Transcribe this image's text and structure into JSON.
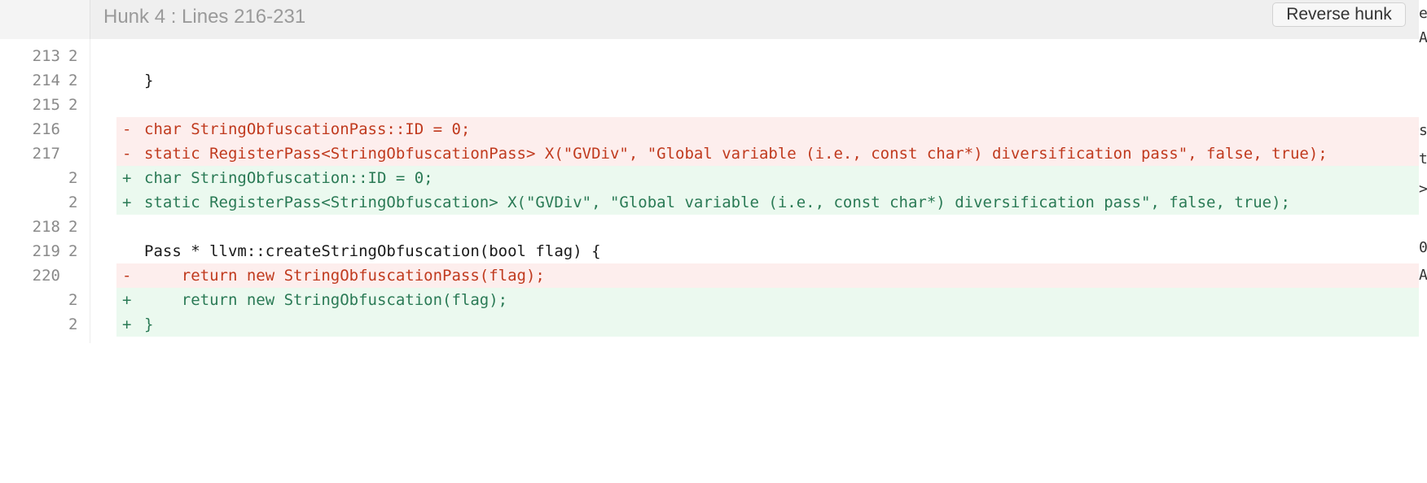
{
  "hunk": {
    "title": "Hunk 4 : Lines 216-231",
    "reverse_label": "Reverse hunk"
  },
  "lines": [
    {
      "type": "context",
      "old": "213",
      "new": "2",
      "marker": "",
      "code": ""
    },
    {
      "type": "context",
      "old": "214",
      "new": "2",
      "marker": "",
      "code": "}"
    },
    {
      "type": "context",
      "old": "215",
      "new": "2",
      "marker": "",
      "code": ""
    },
    {
      "type": "del",
      "old": "216",
      "new": "",
      "marker": "-",
      "code": "char StringObfuscationPass::ID = 0;"
    },
    {
      "type": "del",
      "old": "217",
      "new": "",
      "marker": "-",
      "code": "static RegisterPass<StringObfuscationPass> X(\"GVDiv\", \"Global variable (i.e., const char*) diversification pass\", false, true);"
    },
    {
      "type": "add",
      "old": "",
      "new": "2",
      "marker": "+",
      "code": "char StringObfuscation::ID = 0;"
    },
    {
      "type": "add",
      "old": "",
      "new": "2",
      "marker": "+",
      "code": "static RegisterPass<StringObfuscation> X(\"GVDiv\", \"Global variable (i.e., const char*) diversification pass\", false, true);"
    },
    {
      "type": "context",
      "old": "218",
      "new": "2",
      "marker": "",
      "code": ""
    },
    {
      "type": "context",
      "old": "219",
      "new": "2",
      "marker": "",
      "code": "Pass * llvm::createStringObfuscation(bool flag) {"
    },
    {
      "type": "del",
      "old": "220",
      "new": "",
      "marker": "-",
      "code": "    return new StringObfuscationPass(flag);"
    },
    {
      "type": "add",
      "old": "",
      "new": "2",
      "marker": "+",
      "code": "    return new StringObfuscation(flag);"
    },
    {
      "type": "add",
      "old": "",
      "new": "2",
      "marker": "+",
      "code": "}"
    }
  ],
  "edge_glyphs": [
    "e",
    "A",
    "s",
    "t",
    ">",
    "0",
    "A"
  ],
  "colors": {
    "deleted_bg": "#fdeeed",
    "added_bg": "#ebf9ef",
    "deleted_text": "#c03a1e",
    "added_text": "#2a7a55"
  }
}
